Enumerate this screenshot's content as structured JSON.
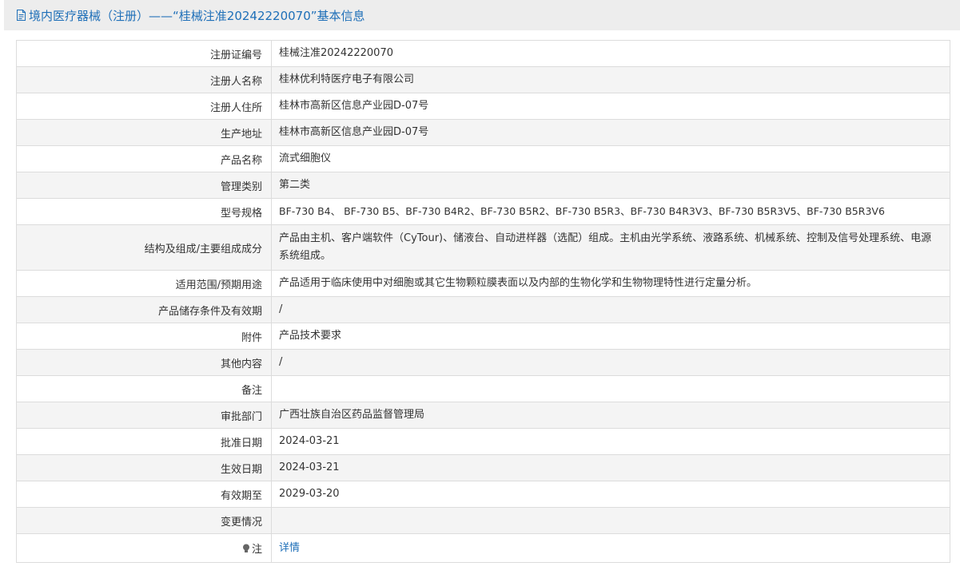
{
  "header": {
    "title": "境内医疗器械（注册）——“桂械注准20242220070”基本信息",
    "icon": "document-icon"
  },
  "rows": [
    {
      "label": "注册证编号",
      "value": "桂械注准20242220070"
    },
    {
      "label": "注册人名称",
      "value": "桂林优利特医疗电子有限公司"
    },
    {
      "label": "注册人住所",
      "value": "桂林市高新区信息产业园D-07号"
    },
    {
      "label": "生产地址",
      "value": "桂林市高新区信息产业园D-07号"
    },
    {
      "label": "产品名称",
      "value": "流式细胞仪"
    },
    {
      "label": "管理类别",
      "value": "第二类"
    },
    {
      "label": "型号规格",
      "value": "BF-730 B4、 BF-730 B5、BF-730 B4R2、BF-730 B5R2、BF-730 B5R3、BF-730 B4R3V3、BF-730 B5R3V5、BF-730 B5R3V6"
    },
    {
      "label": "结构及组成/主要组成成分",
      "value": "产品由主机、客户端软件（CyTour)、储液台、自动进样器（选配）组成。主机由光学系统、液路系统、机械系统、控制及信号处理系统、电源系统组成。"
    },
    {
      "label": "适用范围/预期用途",
      "value": "产品适用于临床使用中对细胞或其它生物颗粒膜表面以及内部的生物化学和生物物理特性进行定量分析。"
    },
    {
      "label": "产品储存条件及有效期",
      "value": "/"
    },
    {
      "label": "附件",
      "value": "产品技术要求"
    },
    {
      "label": "其他内容",
      "value": "/"
    },
    {
      "label": "备注",
      "value": ""
    },
    {
      "label": "审批部门",
      "value": "广西壮族自治区药品监督管理局"
    },
    {
      "label": "批准日期",
      "value": "2024-03-21"
    },
    {
      "label": "生效日期",
      "value": "2024-03-21"
    },
    {
      "label": "有效期至",
      "value": "2029-03-20"
    },
    {
      "label": "变更情况",
      "value": ""
    }
  ],
  "note_row": {
    "label": "注",
    "icon": "lightbulb-icon",
    "link_text": "详情"
  },
  "colors": {
    "title_bar_bg": "#ededed",
    "title_text": "#1e6fb8",
    "row_alt_bg": "#f4f4f4",
    "border": "#dcdcdc",
    "link": "#1e6fb8"
  }
}
